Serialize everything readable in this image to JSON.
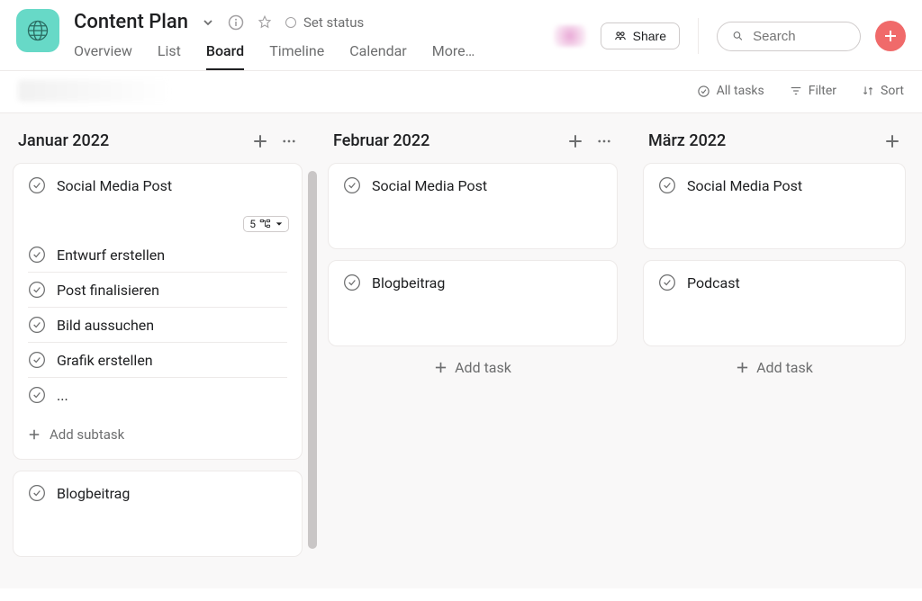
{
  "header": {
    "title": "Content Plan",
    "set_status": "Set status",
    "share_label": "Share",
    "search_placeholder": "Search"
  },
  "tabs": [
    {
      "label": "Overview",
      "active": false
    },
    {
      "label": "List",
      "active": false
    },
    {
      "label": "Board",
      "active": true
    },
    {
      "label": "Timeline",
      "active": false
    },
    {
      "label": "Calendar",
      "active": false
    },
    {
      "label": "More…",
      "active": false
    }
  ],
  "toolbar": {
    "all_tasks": "All tasks",
    "filter": "Filter",
    "sort": "Sort"
  },
  "columns": [
    {
      "title": "Januar 2022",
      "cards": [
        {
          "title": "Social Media Post",
          "subtask_count": "5",
          "subtasks": [
            "Entwurf erstellen",
            "Post finalisieren",
            "Bild aussuchen",
            "Grafik erstellen",
            "..."
          ],
          "add_subtask": "Add subtask"
        },
        {
          "title": "Blogbeitrag"
        }
      ]
    },
    {
      "title": "Februar 2022",
      "cards": [
        {
          "title": "Social Media Post"
        },
        {
          "title": "Blogbeitrag"
        }
      ],
      "add_task": "Add task"
    },
    {
      "title": "März 2022",
      "cards": [
        {
          "title": "Social Media Post"
        },
        {
          "title": "Podcast"
        }
      ],
      "add_task": "Add task"
    }
  ]
}
